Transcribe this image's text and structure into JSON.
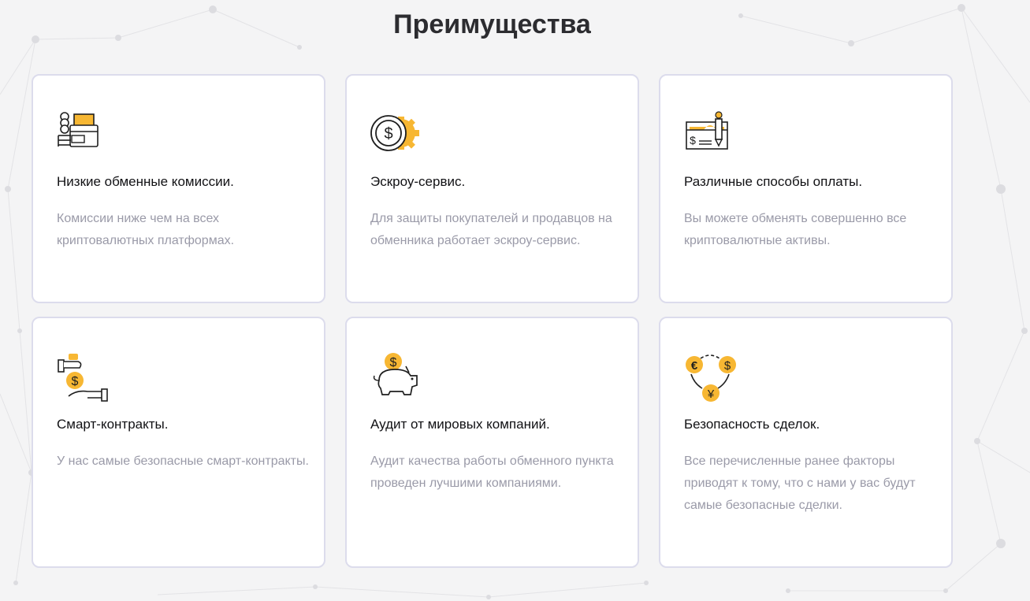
{
  "section": {
    "title": "Преимущества"
  },
  "colors": {
    "accent": "#f7b733",
    "icon_stroke": "#1f1f1f",
    "card_border": "#dcdcec",
    "title_text": "#111114",
    "desc_text": "#9a9aa8"
  },
  "cards": [
    {
      "icon": "coins-wallet-icon",
      "title": "Низкие обменные комиссии.",
      "description": "Комиссии ниже чем на всех криптовалютных платформах."
    },
    {
      "icon": "dollar-coin-gear-icon",
      "title": "Эскроу-сервис.",
      "description": "Для защиты покупателей и продавцов на обменника работает эскроу-сервис."
    },
    {
      "icon": "check-pen-icon",
      "title": "Различные способы оплаты.",
      "description": "Вы можете обменять совершенно все криптовалютные активы."
    },
    {
      "icon": "hands-coin-icon",
      "title": "Смарт-контракты.",
      "description": "У нас самые безопасные смарт-контракты."
    },
    {
      "icon": "piggy-bank-icon",
      "title": "Аудит от мировых компаний.",
      "description": "Аудит качества работы обменного пункта проведен лучшими компаниями."
    },
    {
      "icon": "currency-exchange-icon",
      "title": "Безопасность сделок.",
      "description": "Все перечисленные ранее факторы приводят к тому, что с нами у вас будут самые безопасные сделки."
    }
  ]
}
